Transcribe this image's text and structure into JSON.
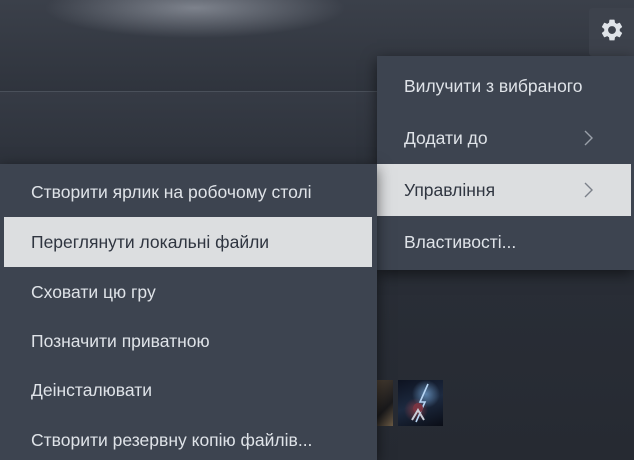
{
  "primary_menu": {
    "items": [
      {
        "label": "Вилучити з вибраного",
        "has_submenu": false,
        "highlighted": false
      },
      {
        "label": "Додати до",
        "has_submenu": true,
        "highlighted": false
      },
      {
        "label": "Управління",
        "has_submenu": true,
        "highlighted": true
      },
      {
        "label": "Властивості...",
        "has_submenu": false,
        "highlighted": false
      }
    ]
  },
  "manage_submenu": {
    "items": [
      {
        "label": "Створити ярлик на робочому столі",
        "highlighted": false
      },
      {
        "label": "Переглянути локальні файли",
        "highlighted": true
      },
      {
        "label": "Сховати цю гру",
        "highlighted": false
      },
      {
        "label": "Позначити приватною",
        "highlighted": false
      },
      {
        "label": "Деінсталювати",
        "highlighted": false
      },
      {
        "label": "Створити резервну копію файлів...",
        "highlighted": false
      }
    ]
  },
  "icons": {
    "settings": "gear-icon",
    "submenu_arrow": "chevron-right-icon"
  },
  "colors": {
    "menu_background": "#3d4450",
    "highlight_background": "#dcdee0",
    "menu_text": "#dfe3e8",
    "highlight_text": "#2f3540",
    "page_background": "#2a2f38"
  }
}
